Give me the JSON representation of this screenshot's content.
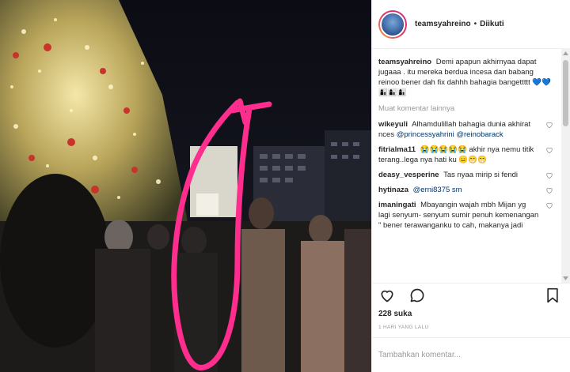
{
  "post": {
    "username": "teamsyahreino",
    "separator": "•",
    "follow_status": "Diikuti",
    "caption_text": "Demi apapun akhirnyaa dapat jugaaa . itu mereka berdua incesa dan babang reinoo bener dah fix dahhh bahagia bangettttt 💙💙👩‍👦👩‍👦👩‍👦",
    "load_more_label": "Muat komentar lainnya",
    "likes_text": "228 suka",
    "timestamp": "1 HARI YANG LALU",
    "add_comment_placeholder": "Tambahkan komentar..."
  },
  "comments": [
    {
      "user": "wikeyuli",
      "text": "Alhamdulillah bahagia dunia akhirat nces ",
      "mention": "@princessyahrini @reinobarack"
    },
    {
      "user": "fitrialma11",
      "text": "😭😭😭😭😭 akhir nya nemu titik terang..lega nya hati ku 😑😁😁",
      "mention": ""
    },
    {
      "user": "deasy_vesperine",
      "text": "Tas nyaa mirip si fendi",
      "mention": ""
    },
    {
      "user": "hytinaza",
      "text": "",
      "mention": "@erni8375 sm"
    },
    {
      "user": "imaningati",
      "text": "Mbayangin wajah mbh Mijan yg lagi senyum- senyum sumir penuh kemenangan \" bener terawanganku to cah, makanya jadi",
      "mention": ""
    }
  ],
  "icons": {
    "like": "heart-icon",
    "comment": "comment-icon",
    "save": "bookmark-icon",
    "comment_like": "heart-icon"
  },
  "colors": {
    "text": "#262626",
    "muted": "#999999",
    "mention": "#003569",
    "border": "#efefef",
    "annotation_stroke": "#ff2d8e"
  }
}
